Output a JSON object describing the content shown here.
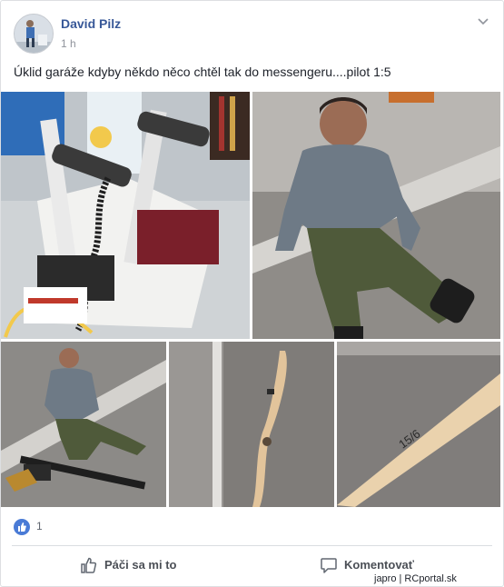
{
  "post": {
    "author": "David Pilz",
    "timestamp": "1 h",
    "text": "Úklid garáže kdyby někdo něco chtěl tak do messengeru....pilot 1:5"
  },
  "photos": [
    {
      "name": "photo-garage-items"
    },
    {
      "name": "photo-pilot-figure-sitting"
    },
    {
      "name": "photo-pilot-figure-with-gun"
    },
    {
      "name": "photo-propeller"
    },
    {
      "name": "photo-propeller-closeup",
      "label": "15/6"
    }
  ],
  "reactions": {
    "like_count": "1"
  },
  "actions": {
    "like_label": "Páči sa mi to",
    "comment_label": "Komentovať"
  },
  "watermark": "japro | RCportal.sk",
  "colors": {
    "author": "#385898",
    "like_badge": "#4a7bd6",
    "action_text": "#4b4f56"
  }
}
